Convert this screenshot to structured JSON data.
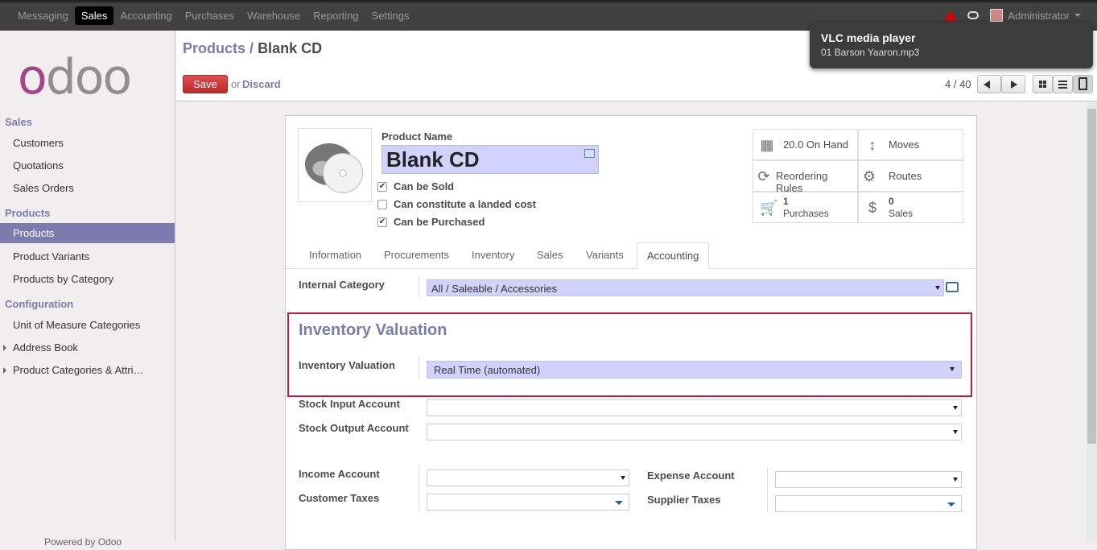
{
  "topbar": {
    "menu": [
      "Messaging",
      "Sales",
      "Accounting",
      "Purchases",
      "Warehouse",
      "Reporting",
      "Settings"
    ],
    "active": "Sales",
    "user": "Administrator"
  },
  "sidebar": {
    "logo": "odoo",
    "groups": [
      {
        "title": "Sales",
        "items": [
          "Customers",
          "Quotations",
          "Sales Orders"
        ]
      },
      {
        "title": "Products",
        "items": [
          "Products",
          "Product Variants",
          "Products by Category"
        ]
      },
      {
        "title": "Configuration",
        "items": [
          "Unit of Measure Categories",
          "Address Book",
          "Product Categories & Attri…"
        ]
      }
    ],
    "active_item": "Products",
    "footer": "Powered by Odoo"
  },
  "control_panel": {
    "breadcrumb_parent": "Products",
    "breadcrumb_sep": "/",
    "breadcrumb_current": "Blank CD",
    "save_label": "Save",
    "or_text": "or",
    "discard_label": "Discard",
    "pager": "4 / 40"
  },
  "notification": {
    "title": "VLC media player",
    "subtitle": "01 Barson Yaaron.mp3"
  },
  "product": {
    "name_label": "Product Name",
    "name": "Blank CD",
    "checkboxes": [
      {
        "label": "Can be Sold",
        "checked": true
      },
      {
        "label": "Can constitute a landed cost",
        "checked": false
      },
      {
        "label": "Can be Purchased",
        "checked": true
      }
    ]
  },
  "smart_buttons": {
    "on_hand": "20.0 On Hand",
    "moves": "Moves",
    "reordering": "Reordering Rules",
    "routes": "Routes",
    "purchases_count": "1",
    "purchases_label": "Purchases",
    "sales_count": "0",
    "sales_label": "Sales"
  },
  "tabs": [
    "Information",
    "Procurements",
    "Inventory",
    "Sales",
    "Variants",
    "Accounting"
  ],
  "active_tab": "Accounting",
  "accounting": {
    "internal_category_label": "Internal Category",
    "internal_category_value": "All / Saleable / Accessories",
    "section_title": "Inventory Valuation",
    "inventory_valuation_label": "Inventory Valuation",
    "inventory_valuation_value": "Real Time (automated)",
    "stock_input_label": "Stock Input Account",
    "stock_output_label": "Stock Output Account",
    "income_label": "Income Account",
    "expense_label": "Expense Account",
    "customer_taxes_label": "Customer Taxes",
    "supplier_taxes_label": "Supplier Taxes"
  },
  "colors": {
    "accent": "#7c7bad",
    "save": "#dc3c3c",
    "required_field": "#d2d2ff",
    "highlight_box": "#c41e3a"
  }
}
